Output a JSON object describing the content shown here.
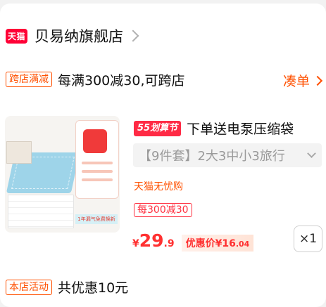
{
  "shop": {
    "badge": "天猫",
    "name": "贝易纳旗舰店"
  },
  "promo": {
    "tag": "跨店满减",
    "text": "每满300减30,可跨店",
    "action": "凑单"
  },
  "product": {
    "flag": "55划算节",
    "title": "下单送电泵压缩袋",
    "sku": "【9件套】2大3中小3旅行",
    "no_discount": "天猫无忧购",
    "coupon_tag": "每300减30",
    "price": {
      "currency": "¥",
      "integer": "29",
      "decimal": ".9"
    },
    "coupon_price": {
      "label": "优惠价",
      "currency": "¥",
      "integer": "16",
      "decimal": ".04"
    },
    "image_banner": "1年漏气免费换新",
    "quantity": "×1"
  },
  "store_activity": {
    "tag": "本店活动",
    "text": "共优惠10元"
  },
  "colors": {
    "accent": "#ff5000",
    "price": "#ff3030",
    "tmall": "#ff0036"
  }
}
